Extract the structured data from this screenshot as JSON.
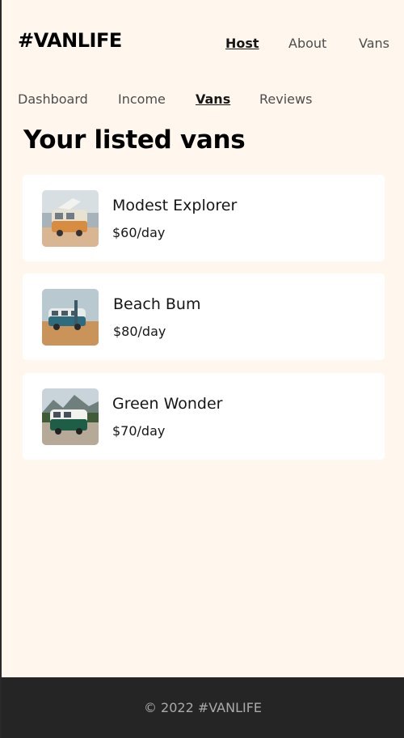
{
  "header": {
    "logo": "#VANLIFE",
    "nav": {
      "host": "Host",
      "about": "About",
      "vans": "Vans"
    }
  },
  "host_nav": {
    "dashboard": "Dashboard",
    "income": "Income",
    "vans": "Vans",
    "reviews": "Reviews"
  },
  "main": {
    "title": "Your listed vans",
    "vans": [
      {
        "name": "Modest Explorer",
        "price": "$60/day"
      },
      {
        "name": "Beach Bum",
        "price": "$80/day"
      },
      {
        "name": "Green Wonder",
        "price": "$70/day"
      }
    ]
  },
  "footer": {
    "copyright": "© 2022 #VANLIFE"
  },
  "colors": {
    "page_bg": "#FFF7ED",
    "card_bg": "#FFFFFF",
    "footer_bg": "#252525",
    "text": "#161616"
  }
}
